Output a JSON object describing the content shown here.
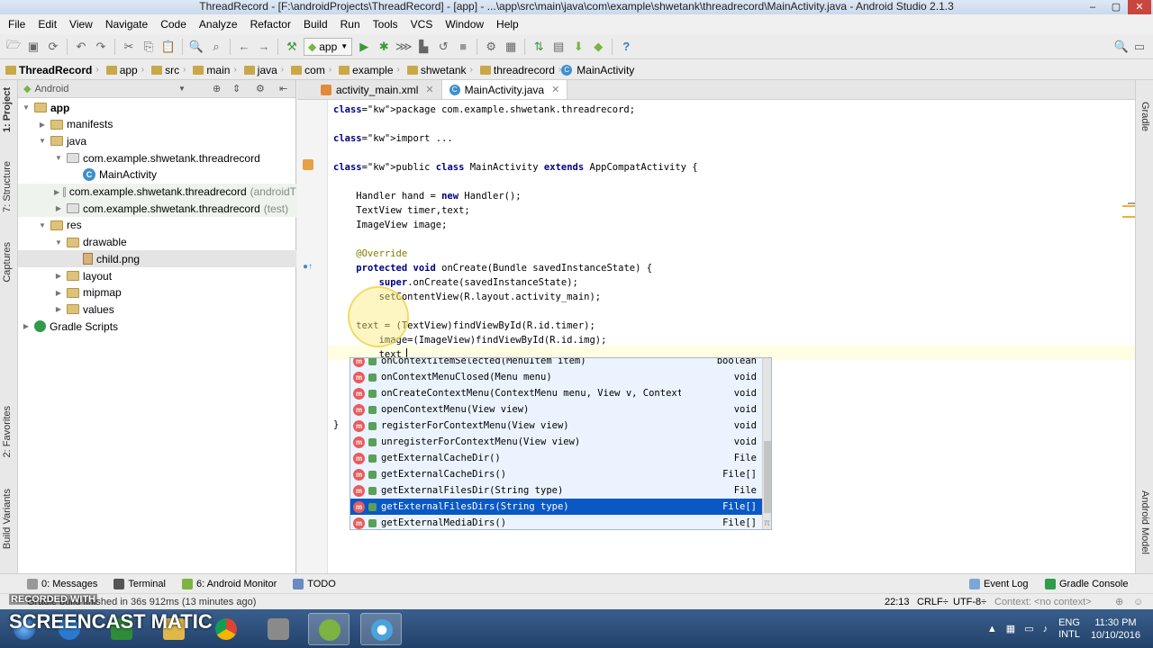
{
  "window": {
    "title": "ThreadRecord - [F:\\androidProjects\\ThreadRecord] - [app] - ...\\app\\src\\main\\java\\com\\example\\shwetank\\threadrecord\\MainActivity.java - Android Studio 2.1.3",
    "controls": [
      "–",
      "▢",
      "✕"
    ]
  },
  "menu": [
    "File",
    "Edit",
    "View",
    "Navigate",
    "Code",
    "Analyze",
    "Refactor",
    "Build",
    "Run",
    "Tools",
    "VCS",
    "Window",
    "Help"
  ],
  "toolbar": {
    "run_config": "app",
    "help": "?"
  },
  "breadcrumb": [
    "ThreadRecord",
    "app",
    "src",
    "main",
    "java",
    "com",
    "example",
    "shwetank",
    "threadrecord",
    "MainActivity"
  ],
  "side_tabs_left": [
    "1: Project",
    "7: Structure",
    "Captures",
    "2: Favorites",
    "Build Variants"
  ],
  "side_tabs_right": [
    "Gradle",
    "Android Model"
  ],
  "project_panel": {
    "view_mode": "Android",
    "tree": [
      {
        "label": "app",
        "depth": 0,
        "icon": "folder",
        "expanded": true,
        "bold": true
      },
      {
        "label": "manifests",
        "depth": 1,
        "icon": "folder",
        "expanded": false
      },
      {
        "label": "java",
        "depth": 1,
        "icon": "folder",
        "expanded": true
      },
      {
        "label": "com.example.shwetank.threadrecord",
        "depth": 2,
        "icon": "package",
        "expanded": true
      },
      {
        "label": "MainActivity",
        "depth": 3,
        "icon": "class"
      },
      {
        "label": "com.example.shwetank.threadrecord",
        "hint": "(androidT",
        "depth": 2,
        "icon": "package",
        "expanded": false,
        "shade": true
      },
      {
        "label": "com.example.shwetank.threadrecord",
        "hint": "(test)",
        "depth": 2,
        "icon": "package",
        "expanded": false,
        "shade": true
      },
      {
        "label": "res",
        "depth": 1,
        "icon": "folder",
        "expanded": true
      },
      {
        "label": "drawable",
        "depth": 2,
        "icon": "folder",
        "expanded": true
      },
      {
        "label": "child.png",
        "depth": 3,
        "icon": "png",
        "selected": true
      },
      {
        "label": "layout",
        "depth": 2,
        "icon": "folder",
        "expanded": false
      },
      {
        "label": "mipmap",
        "depth": 2,
        "icon": "folder",
        "expanded": false
      },
      {
        "label": "values",
        "depth": 2,
        "icon": "folder",
        "expanded": false
      },
      {
        "label": "Gradle Scripts",
        "depth": 0,
        "icon": "gradle",
        "expanded": false
      }
    ]
  },
  "editor_tabs": [
    {
      "label": "activity_main.xml",
      "icon": "xml",
      "active": false
    },
    {
      "label": "MainActivity.java",
      "icon": "class",
      "active": true
    }
  ],
  "code_lines": [
    "package com.example.shwetank.threadrecord;",
    "",
    "import ...",
    "",
    "public class MainActivity extends AppCompatActivity {",
    "",
    "    Handler hand = new Handler();",
    "    TextView timer,text;",
    "    ImageView image;",
    "",
    "    @Override",
    "    protected void onCreate(Bundle savedInstanceState) {",
    "        super.onCreate(savedInstanceState);",
    "        setContentView(R.layout.activity_main);",
    "",
    "    text = (TextView)findViewById(R.id.timer);",
    "        image=(ImageView)findViewById(R.id.img);",
    "        text"
  ],
  "closing_brace": "}",
  "autocomplete": {
    "items": [
      {
        "sig": "onContextItemSelected(MenuItem item)",
        "type": "boolean"
      },
      {
        "sig": "onContextMenuClosed(Menu menu)",
        "type": "void"
      },
      {
        "sig": "onCreateContextMenu(ContextMenu menu, View v, ContextMe...",
        "type": "void"
      },
      {
        "sig": "openContextMenu(View view)",
        "type": "void"
      },
      {
        "sig": "registerForContextMenu(View view)",
        "type": "void"
      },
      {
        "sig": "unregisterForContextMenu(View view)",
        "type": "void"
      },
      {
        "sig": "getExternalCacheDir()",
        "type": "File"
      },
      {
        "sig": "getExternalCacheDirs()",
        "type": "File[]"
      },
      {
        "sig": "getExternalFilesDir(String type)",
        "type": "File"
      },
      {
        "sig": "getExternalFilesDirs(String type)",
        "type": "File[]",
        "selected": true
      },
      {
        "sig": "getExternalMediaDirs()",
        "type": "File[]"
      }
    ],
    "method_icon": "m",
    "pi": "π"
  },
  "tool_windows": {
    "left": [
      "0: Messages",
      "Terminal",
      "6: Android Monitor",
      "TODO"
    ],
    "right": [
      "Event Log",
      "Gradle Console"
    ]
  },
  "status": {
    "message": "Gradle build finished in 36s 912ms (13 minutes ago)",
    "position": "22:13",
    "line_sep": "CRLF÷",
    "encoding": "UTF-8÷",
    "context": "Context: <no context>"
  },
  "watermark": {
    "small": "RECORDED WITH",
    "big": "SCREENCAST MATIC"
  },
  "taskbar": {
    "lang": "ENG",
    "layout": "INTL",
    "time": "11:30 PM",
    "date": "10/10/2016"
  }
}
